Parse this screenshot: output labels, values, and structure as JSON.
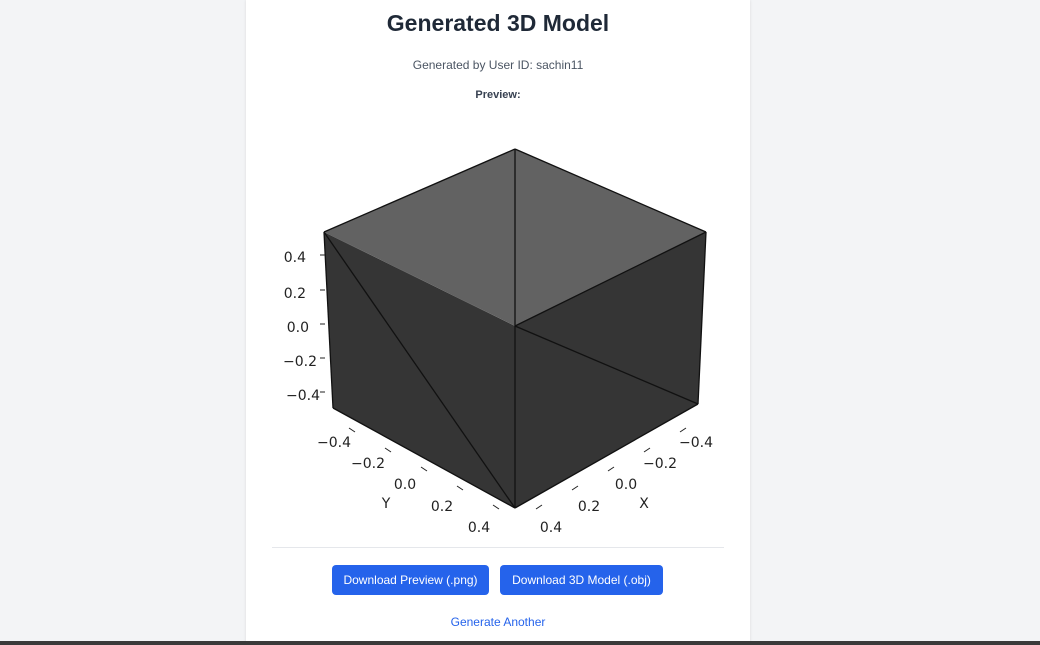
{
  "page": {
    "title": "Generated 3D Model",
    "subtitle": "Generated by User ID: sachin11",
    "preview_label": "Preview:"
  },
  "preview": {
    "z_ticks": [
      "0.4",
      "0.2",
      "0.0",
      "−0.2",
      "−0.4"
    ],
    "y_ticks": [
      "−0.4",
      "−0.2",
      "0.0",
      "0.2",
      "0.4"
    ],
    "x_ticks": [
      "−0.4",
      "−0.2",
      "0.0",
      "0.2",
      "0.4"
    ],
    "y_label": "Y",
    "x_label": "X",
    "colors": {
      "top_face": "#626262",
      "side_faces": "#353535",
      "edges": "#111111"
    }
  },
  "actions": {
    "download_png_label": "Download Preview (.png)",
    "download_obj_label": "Download 3D Model (.obj)",
    "generate_another_label": "Generate Another"
  },
  "theme": {
    "primary": "#2563eb",
    "background": "#f3f4f6"
  }
}
